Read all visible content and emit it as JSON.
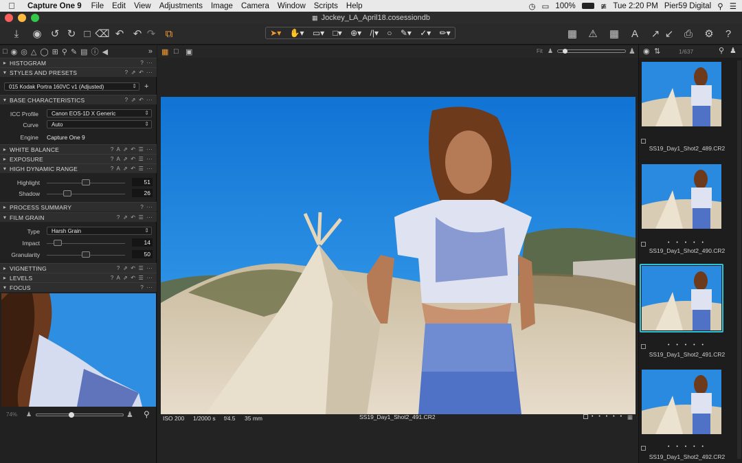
{
  "menubar": {
    "apple": "",
    "app_name": "Capture One 9",
    "menus": [
      "File",
      "Edit",
      "View",
      "Adjustments",
      "Image",
      "Camera",
      "Window",
      "Scripts",
      "Help"
    ],
    "battery": "100%",
    "clock": "Tue 2:20 PM",
    "user": "Pier59 Digital"
  },
  "window": {
    "title": "Jockey_LA_April18.cosessiondb"
  },
  "colors": {
    "accent": "#f29a30",
    "selected_thumb": "#2ec4d8",
    "sky": "#1f8fe0"
  },
  "left_panel": {
    "sections": {
      "histogram": "HISTOGRAM",
      "styles": "STYLES AND PRESETS",
      "base": "BASE CHARACTERISTICS",
      "white_balance": "WHITE BALANCE",
      "exposure": "EXPOSURE",
      "hdr": "HIGH DYNAMIC RANGE",
      "process_summary": "PROCESS SUMMARY",
      "film_grain": "FILM GRAIN",
      "vignetting": "VIGNETTING",
      "levels": "LEVELS",
      "focus": "FOCUS"
    },
    "style_value": "015 Kodak Portra 160VC v1 (Adjusted)",
    "base": {
      "icc_label": "ICC Profile",
      "icc_value": "Canon EOS-1D X Generic",
      "curve_label": "Curve",
      "curve_value": "Auto",
      "engine_label": "Engine",
      "engine_value": "Capture One 9"
    },
    "hdr": {
      "highlight_label": "Highlight",
      "highlight_value": "51",
      "shadow_label": "Shadow",
      "shadow_value": "26"
    },
    "film_grain": {
      "type_label": "Type",
      "type_value": "Harsh Grain",
      "impact_label": "Impact",
      "impact_value": "14",
      "granularity_label": "Granularity",
      "granularity_value": "50"
    },
    "focus_zoom": "74%"
  },
  "viewer": {
    "fit_label": "Fit",
    "iso": "ISO 200",
    "shutter": "1/2000 s",
    "aperture": "f/4.5",
    "focal": "35 mm",
    "filename": "SS19_Day1_Shot2_491.CR2"
  },
  "browser": {
    "count": "1/637",
    "thumbnails": [
      {
        "name": "SS19_Day1_Shot2_489.CR2",
        "selected": false
      },
      {
        "name": "SS19_Day1_Shot2_490.CR2",
        "selected": false
      },
      {
        "name": "SS19_Day1_Shot2_491.CR2",
        "selected": true
      },
      {
        "name": "SS19_Day1_Shot2_492.CR2",
        "selected": false
      }
    ],
    "rating_dots": "• • • • •"
  }
}
